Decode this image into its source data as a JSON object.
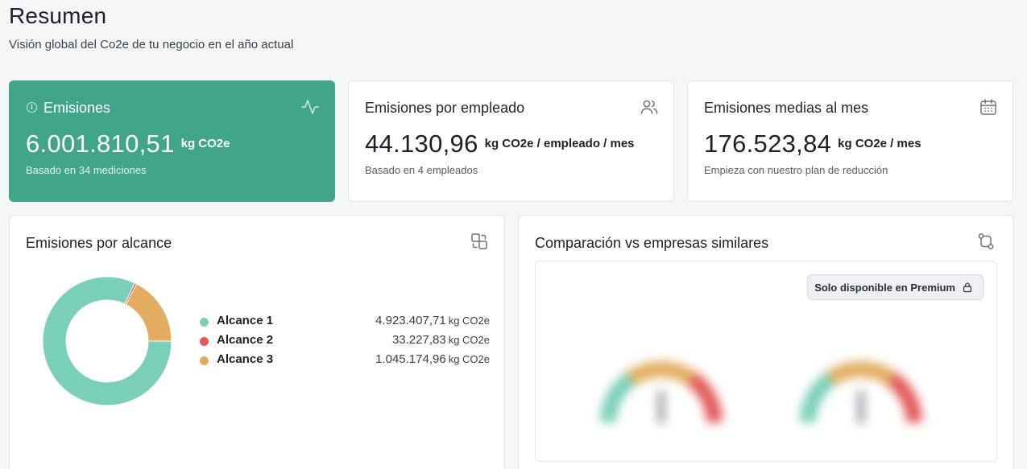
{
  "page": {
    "title": "Resumen",
    "subtitle": "Visión global del Co2e de tu negocio en el año actual"
  },
  "kpis": [
    {
      "title": "Emisiones",
      "value": "6.001.810,51",
      "unit": "kg CO2e",
      "note": "Basado en 34 mediciones",
      "icon": "activity-icon"
    },
    {
      "title": "Emisiones por empleado",
      "value": "44.130,96",
      "unit": "kg CO2e / empleado / mes",
      "note": "Basado en 4 empleados",
      "icon": "users-icon"
    },
    {
      "title": "Emisiones medias al mes",
      "value": "176.523,84",
      "unit": "kg CO2e / mes",
      "note": "Empieza con nuestro plan de reducción",
      "icon": "calendar-icon"
    }
  ],
  "scope_panel": {
    "title": "Emisiones por alcance",
    "icon": "convert-icon",
    "items": [
      {
        "name": "Alcance 1",
        "value": "4.923.407,71",
        "unit": "kg CO2e",
        "color": "#7acfb8",
        "amount": 4923407.71
      },
      {
        "name": "Alcance 2",
        "value": "33.227,83",
        "unit": "kg CO2e",
        "color": "#e25a5a",
        "amount": 33227.83
      },
      {
        "name": "Alcance 3",
        "value": "1.045.174,96",
        "unit": "kg CO2e",
        "color": "#e3ad61",
        "amount": 1045174.96
      }
    ]
  },
  "comparison_panel": {
    "title": "Comparación vs empresas similares",
    "icon": "git-compare-icon",
    "badge": "Solo disponible en Premium",
    "badge_icon": "lock-icon"
  },
  "colors": {
    "accent": "#41a689",
    "gauge_low": "#7acfb8",
    "gauge_mid": "#e3ad61",
    "gauge_high": "#e25a5a"
  }
}
